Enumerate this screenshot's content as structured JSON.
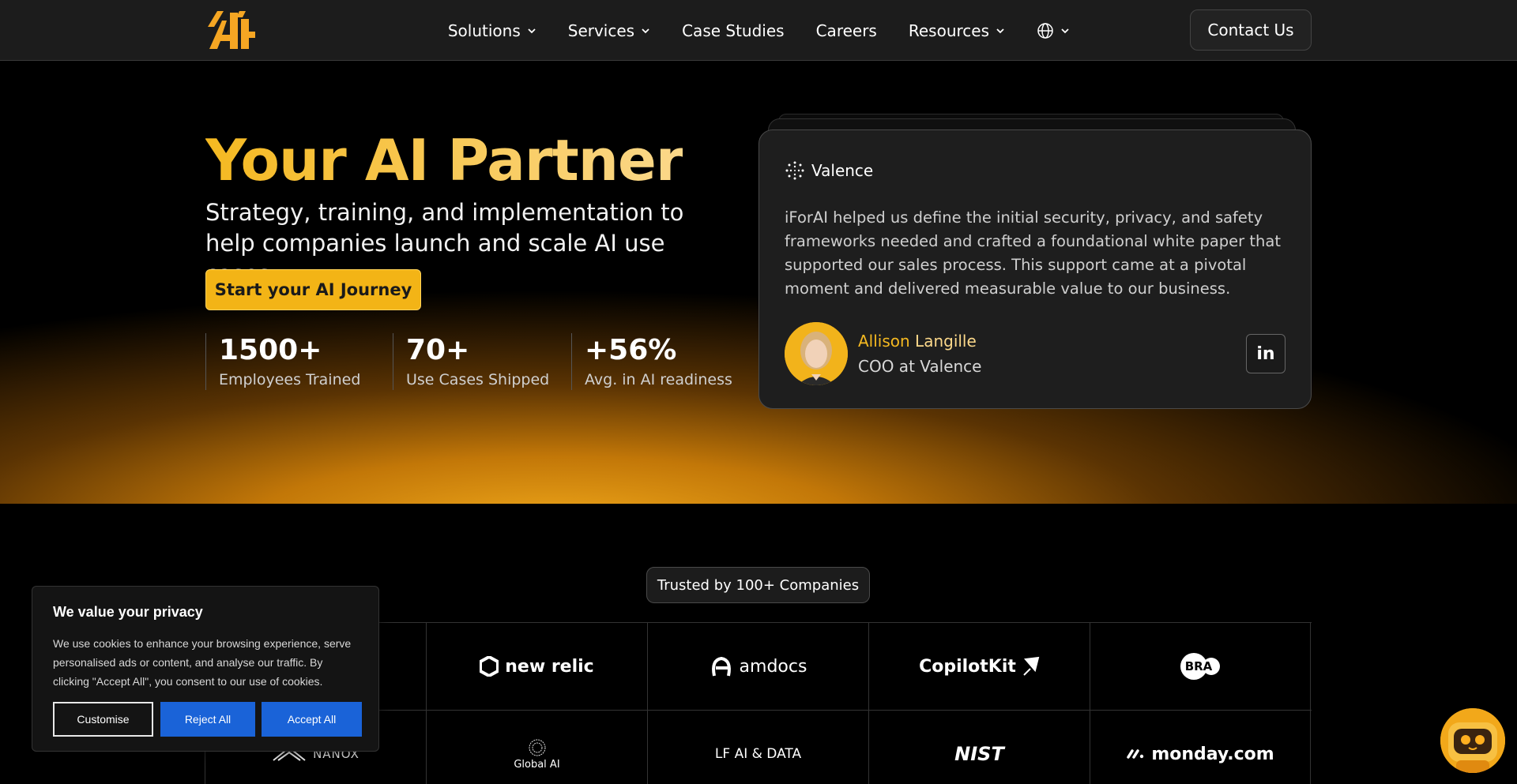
{
  "nav": {
    "items": [
      {
        "label": "Solutions",
        "dropdown": true
      },
      {
        "label": "Services",
        "dropdown": true
      },
      {
        "label": "Case Studies",
        "dropdown": false
      },
      {
        "label": "Careers",
        "dropdown": false
      },
      {
        "label": "Resources",
        "dropdown": true
      }
    ],
    "language_icon": "globe-icon",
    "contact_label": "Contact Us"
  },
  "hero": {
    "title": "Your AI Partner",
    "subtitle": "Strategy, training, and implementation to help companies launch and scale AI use cases.",
    "cta_label": "Start your AI Journey",
    "stats": [
      {
        "value": "1500+",
        "label": "Employees Trained"
      },
      {
        "value": "70+",
        "label": "Use Cases Shipped"
      },
      {
        "value": "+56%",
        "label": "Avg. in AI readiness"
      }
    ]
  },
  "testimonial": {
    "company": "Valence",
    "quote": "iForAI helped us define the initial security, privacy, and safety frameworks needed and crafted a foundational white paper that supported our sales process. This support came at a pivotal moment and delivered measurable value to our business.",
    "first_name": "Allison",
    "last_name": "Langille",
    "role": "COO at Valence",
    "linkedin_label": "in"
  },
  "trusted": {
    "label": "Trusted by 100+ Companies",
    "logos_row1": [
      "new relic",
      "amdocs",
      "CopilotKit",
      "BRA"
    ],
    "logos_row2": [
      "NANOX",
      "Global AI",
      "LF AI & DATA",
      "NIST",
      "monday.com"
    ]
  },
  "cookie": {
    "title": "We value your privacy",
    "text": "We use cookies to enhance your browsing experience, serve personalised ads or content, and analyse our traffic. By clicking \"Accept All\", you consent to our use of cookies.",
    "customise_label": "Customise",
    "reject_label": "Reject All",
    "accept_label": "Accept All"
  },
  "colors": {
    "accent": "#f3b416",
    "accent_light": "#fbd88a",
    "button_blue": "#1a63d8",
    "nav_bg": "#1c1c1c"
  }
}
